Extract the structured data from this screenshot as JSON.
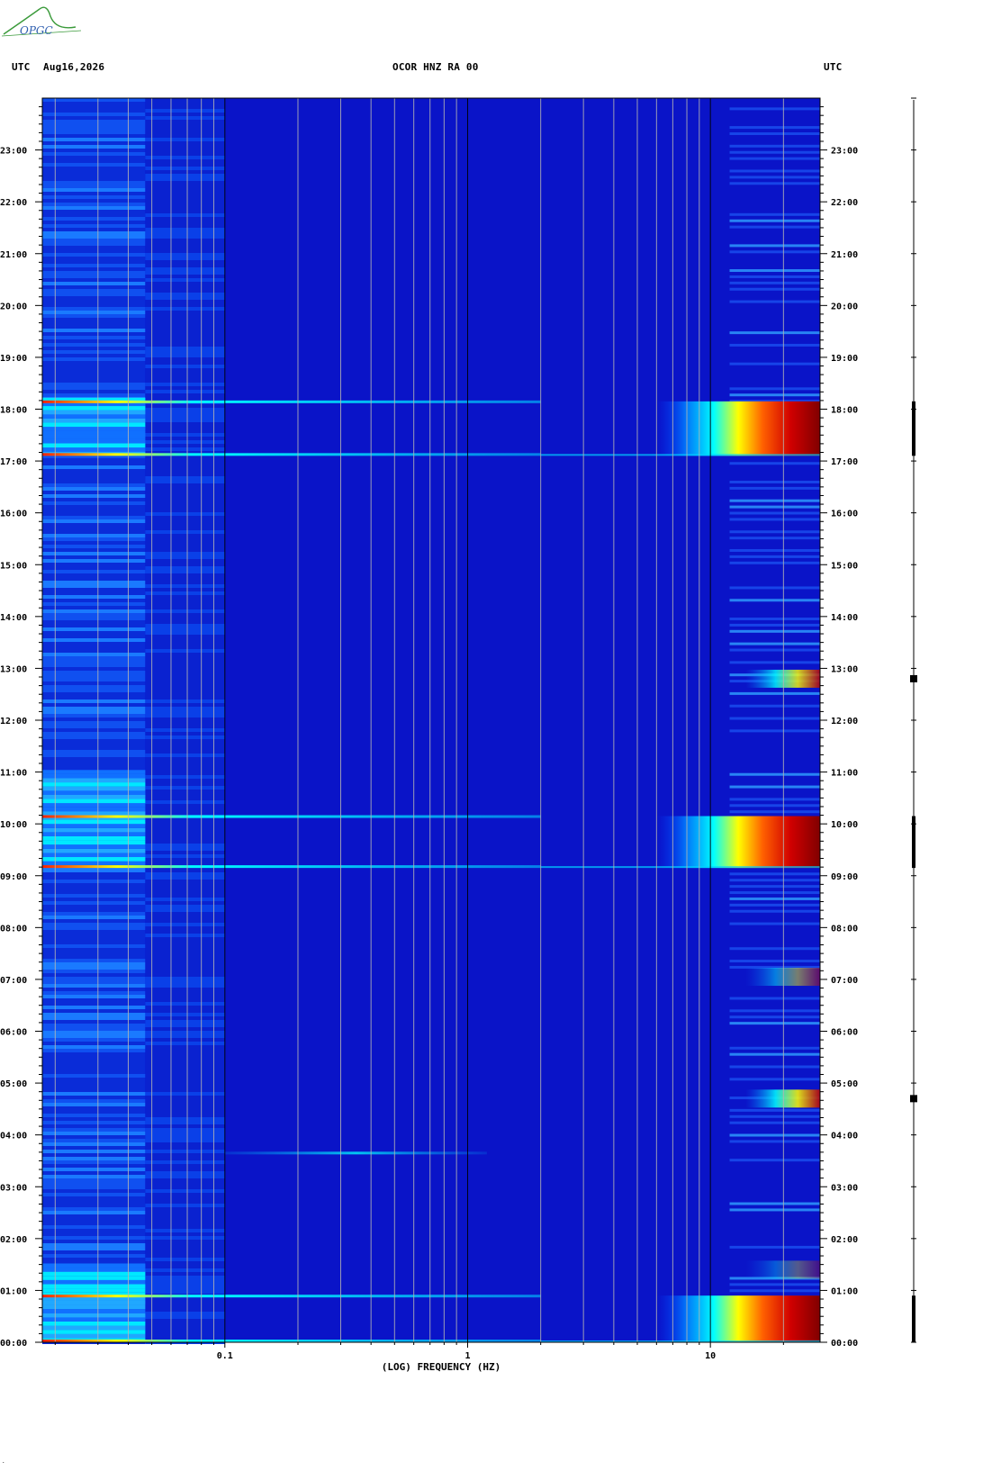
{
  "logo": {
    "text": "OPGC"
  },
  "header": {
    "left_tz": "UTC",
    "date": "Aug16,2026",
    "station": "OCOR HNZ RA 00",
    "right_tz": "UTC"
  },
  "chart_data": {
    "type": "heatmap",
    "title": "OCOR HNZ RA 00",
    "xlabel": "(LOG) FREQUENCY (HZ)",
    "ylabel": "",
    "x_scale": "log",
    "xlim": [
      0.0177,
      28.3
    ],
    "ylim": [
      0,
      24
    ],
    "x_tick_labels": [
      {
        "value": 0.1,
        "label": "0.1"
      },
      {
        "value": 1,
        "label": "1"
      },
      {
        "value": 10,
        "label": "10"
      }
    ],
    "y_tick_labels": [
      "00:00",
      "01:00",
      "02:00",
      "03:00",
      "04:00",
      "05:00",
      "06:00",
      "07:00",
      "08:00",
      "09:00",
      "10:00",
      "11:00",
      "12:00",
      "13:00",
      "14:00",
      "15:00",
      "16:00",
      "17:00",
      "18:00",
      "19:00",
      "20:00",
      "21:00",
      "22:00",
      "23:00"
    ],
    "colormap": [
      "#00008f",
      "#0000ff",
      "#0080ff",
      "#00ffff",
      "#80ff80",
      "#ffff00",
      "#ff8000",
      "#ff0000",
      "#800000"
    ],
    "background_color": "#0a14c8",
    "events": [
      {
        "start_hour": 0.0,
        "end_hour": 0.9,
        "strength": 1.0
      },
      {
        "start_hour": 9.15,
        "end_hour": 10.15,
        "strength": 1.0
      },
      {
        "start_hour": 17.1,
        "end_hour": 18.15,
        "strength": 1.0
      }
    ],
    "hf_patches": [
      {
        "hour": 4.7,
        "strength": 0.85
      },
      {
        "hour": 12.8,
        "strength": 0.8
      },
      {
        "hour": 7.05,
        "strength": 0.45
      },
      {
        "hour": 1.4,
        "strength": 0.3
      }
    ],
    "faint_bands": [
      {
        "hour": 3.65,
        "fmin": 0.1,
        "fmax": 1.2,
        "strength": 0.35
      }
    ],
    "grid": true
  }
}
